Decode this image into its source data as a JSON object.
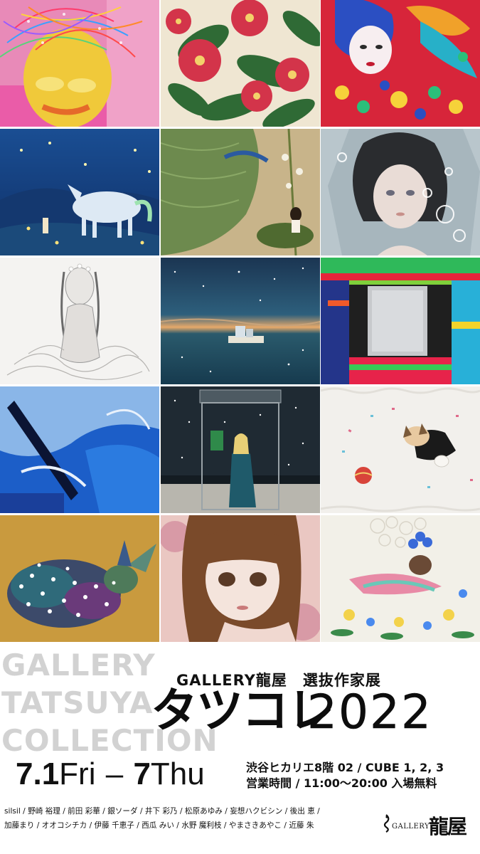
{
  "artwork_grid": {
    "tiles": [
      {
        "name": "artwork-colorful-face"
      },
      {
        "name": "artwork-red-camellias"
      },
      {
        "name": "artwork-geisha-phoenix"
      },
      {
        "name": "artwork-blue-unicorn"
      },
      {
        "name": "artwork-girl-on-leaf"
      },
      {
        "name": "artwork-girl-bubbles"
      },
      {
        "name": "artwork-pencil-woman"
      },
      {
        "name": "artwork-boat-starry-sea"
      },
      {
        "name": "artwork-neon-abstract"
      },
      {
        "name": "artwork-blue-abstract"
      },
      {
        "name": "artwork-phone-booth-girl"
      },
      {
        "name": "artwork-puppy-paper"
      },
      {
        "name": "artwork-dotted-fawn"
      },
      {
        "name": "artwork-brown-hair-girl"
      },
      {
        "name": "artwork-bird-flowers"
      }
    ]
  },
  "background_words": [
    "GALLERY",
    "TATSUYA",
    "COLLECTION"
  ],
  "subtitle": "GALLERY龍屋　選抜作家展",
  "title": {
    "jp": "タツコレ",
    "year": "2022"
  },
  "dates": {
    "start_num": "7.1",
    "start_day": "Fri",
    "dash": "–",
    "end_num": "7",
    "end_day": "Thu"
  },
  "venue": {
    "line1": "渋谷ヒカリエ8階 02 / CUBE 1, 2, 3",
    "line2": "営業時間 / 11:00～20:00 入場無料"
  },
  "artists": {
    "line1": "silsil / 野崎 裕理 / 前田 彩華 / 銀ソーダ / 井下 彩乃 / 松原あゆみ / 妄想ハクビシン / 後出 恵 /",
    "line2": "加藤まり / オオコシチカ / 伊藤 千恵子 / 西瓜 みい / 水野 魔利枝 / やまさきあやこ / 近藤 朱"
  },
  "logo": {
    "small": "GALLERY",
    "big": "龍屋"
  }
}
